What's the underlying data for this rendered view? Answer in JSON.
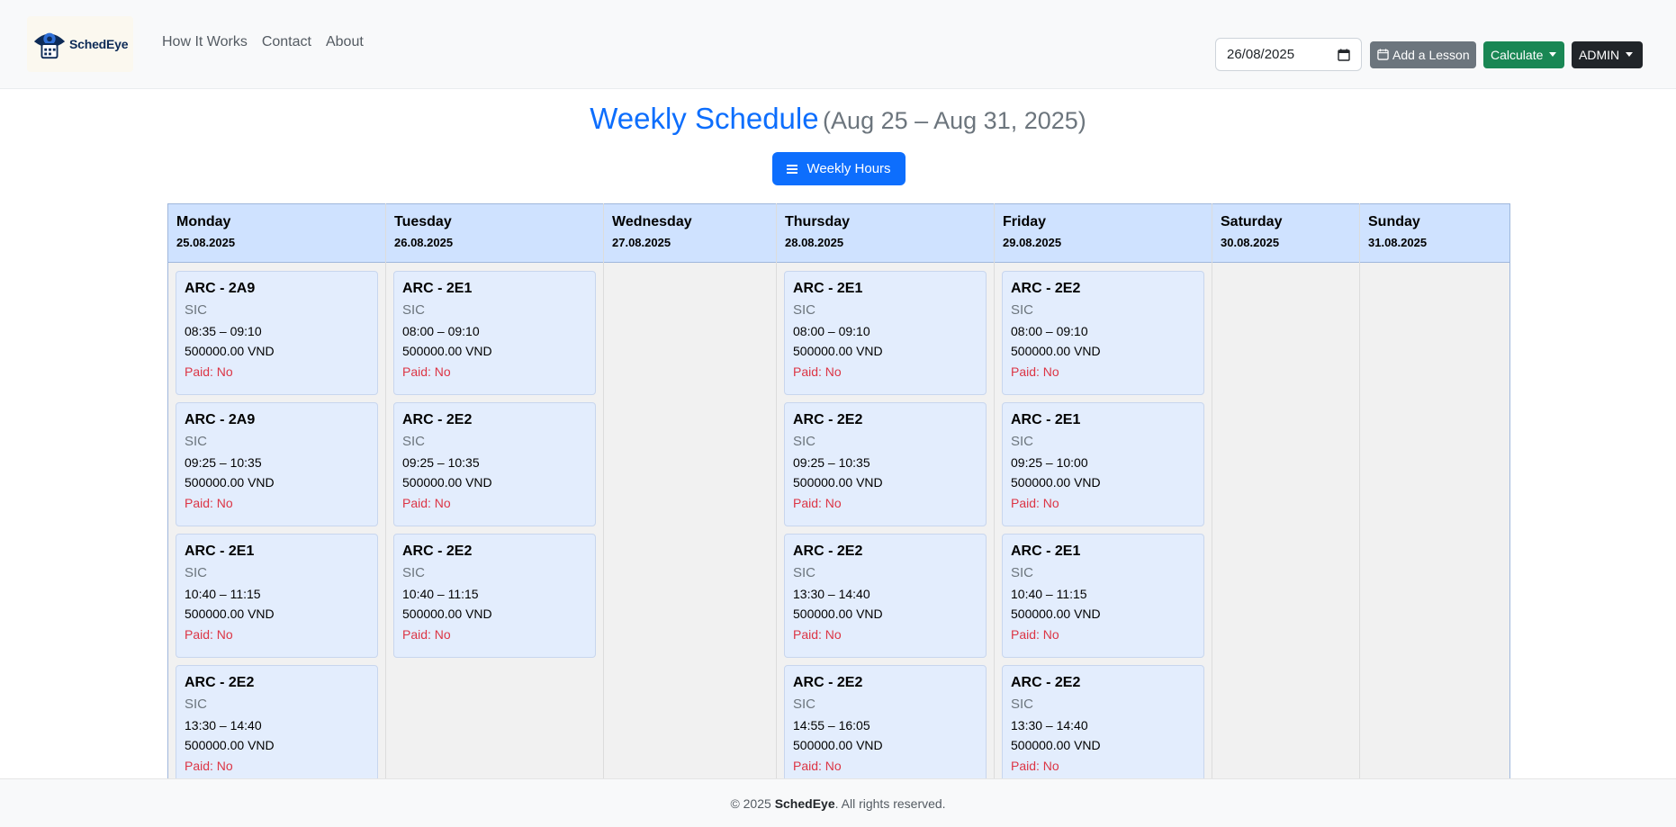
{
  "navbar": {
    "brand": "SchedEye",
    "links": [
      "How It Works",
      "Contact",
      "About"
    ],
    "date_value": "26/08/2025",
    "add_lesson_label": "Add a Lesson",
    "calculate_label": "Calculate",
    "admin_label": "ADMIN"
  },
  "heading": {
    "title": "Weekly Schedule",
    "range": "(Aug 25 – Aug 31, 2025)"
  },
  "weekly_hours_label": "Weekly Hours",
  "days": [
    {
      "day": "Monday",
      "date": "25.08.2025",
      "lessons": [
        {
          "name": "ARC - 2A9",
          "org": "SIC",
          "time": "08:35 – 09:10",
          "price": "500000.00 VND",
          "paid": "Paid: No"
        },
        {
          "name": "ARC - 2A9",
          "org": "SIC",
          "time": "09:25 – 10:35",
          "price": "500000.00 VND",
          "paid": "Paid: No"
        },
        {
          "name": "ARC - 2E1",
          "org": "SIC",
          "time": "10:40 – 11:15",
          "price": "500000.00 VND",
          "paid": "Paid: No"
        },
        {
          "name": "ARC - 2E2",
          "org": "SIC",
          "time": "13:30 – 14:40",
          "price": "500000.00 VND",
          "paid": "Paid: No"
        }
      ]
    },
    {
      "day": "Tuesday",
      "date": "26.08.2025",
      "lessons": [
        {
          "name": "ARC - 2E1",
          "org": "SIC",
          "time": "08:00 – 09:10",
          "price": "500000.00 VND",
          "paid": "Paid: No"
        },
        {
          "name": "ARC - 2E2",
          "org": "SIC",
          "time": "09:25 – 10:35",
          "price": "500000.00 VND",
          "paid": "Paid: No"
        },
        {
          "name": "ARC - 2E2",
          "org": "SIC",
          "time": "10:40 – 11:15",
          "price": "500000.00 VND",
          "paid": "Paid: No"
        }
      ]
    },
    {
      "day": "Wednesday",
      "date": "27.08.2025",
      "lessons": []
    },
    {
      "day": "Thursday",
      "date": "28.08.2025",
      "lessons": [
        {
          "name": "ARC - 2E1",
          "org": "SIC",
          "time": "08:00 – 09:10",
          "price": "500000.00 VND",
          "paid": "Paid: No"
        },
        {
          "name": "ARC - 2E2",
          "org": "SIC",
          "time": "09:25 – 10:35",
          "price": "500000.00 VND",
          "paid": "Paid: No"
        },
        {
          "name": "ARC - 2E2",
          "org": "SIC",
          "time": "13:30 – 14:40",
          "price": "500000.00 VND",
          "paid": "Paid: No"
        },
        {
          "name": "ARC - 2E2",
          "org": "SIC",
          "time": "14:55 – 16:05",
          "price": "500000.00 VND",
          "paid": "Paid: No"
        }
      ]
    },
    {
      "day": "Friday",
      "date": "29.08.2025",
      "lessons": [
        {
          "name": "ARC - 2E2",
          "org": "SIC",
          "time": "08:00 – 09:10",
          "price": "500000.00 VND",
          "paid": "Paid: No"
        },
        {
          "name": "ARC - 2E1",
          "org": "SIC",
          "time": "09:25 – 10:00",
          "price": "500000.00 VND",
          "paid": "Paid: No"
        },
        {
          "name": "ARC - 2E1",
          "org": "SIC",
          "time": "10:40 – 11:15",
          "price": "500000.00 VND",
          "paid": "Paid: No"
        },
        {
          "name": "ARC - 2E2",
          "org": "SIC",
          "time": "13:30 – 14:40",
          "price": "500000.00 VND",
          "paid": "Paid: No"
        }
      ]
    },
    {
      "day": "Saturday",
      "date": "30.08.2025",
      "lessons": []
    },
    {
      "day": "Sunday",
      "date": "31.08.2025",
      "lessons": []
    }
  ],
  "footer": {
    "prefix": "© 2025",
    "brand": "SchedEye",
    "suffix": ". All rights reserved."
  }
}
